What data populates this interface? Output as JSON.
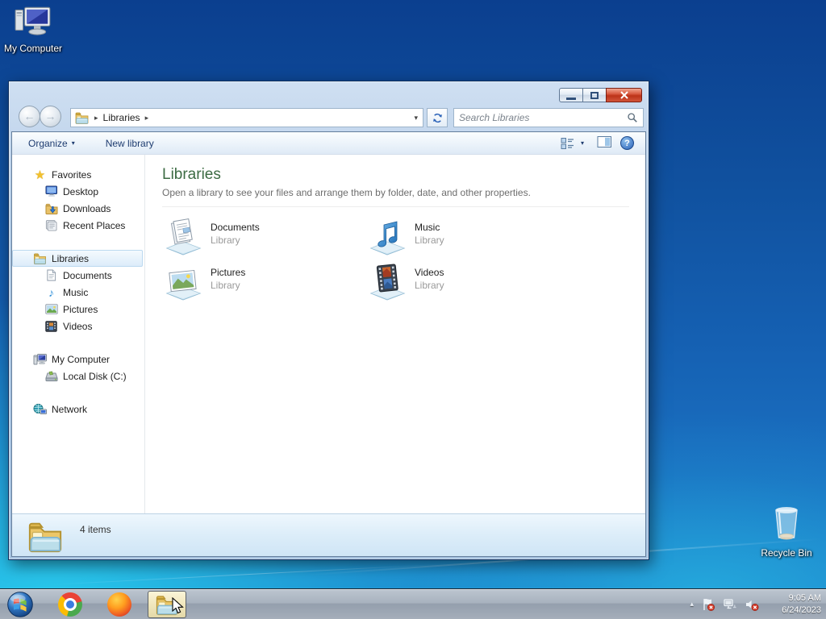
{
  "glyphs": {
    "back_arrow": "←",
    "forward_arrow": "→",
    "chevron_right": "▸",
    "chevron_down": "▾",
    "tray_chevron": "▴",
    "star": "★",
    "music_note": "♪",
    "question": "?"
  },
  "colors": {
    "heading_green": "#3c6b43",
    "close_red": "#bc3318",
    "selection_blue": "#dcecfa"
  },
  "desktop": {
    "my_computer_label": "My Computer",
    "recycle_bin_label": "Recycle Bin"
  },
  "window": {
    "nav": {
      "breadcrumb": "Libraries",
      "search_placeholder": "Search Libraries"
    },
    "toolbar": {
      "organize": "Organize",
      "new_library": "New library"
    },
    "sidebar": {
      "favorites": {
        "label": "Favorites",
        "items": [
          {
            "label": "Desktop"
          },
          {
            "label": "Downloads"
          },
          {
            "label": "Recent Places"
          }
        ]
      },
      "libraries": {
        "label": "Libraries",
        "items": [
          {
            "label": "Documents"
          },
          {
            "label": "Music"
          },
          {
            "label": "Pictures"
          },
          {
            "label": "Videos"
          }
        ]
      },
      "computer": {
        "label": "My Computer",
        "items": [
          {
            "label": "Local Disk (C:)"
          }
        ]
      },
      "network": {
        "label": "Network"
      }
    },
    "content": {
      "title": "Libraries",
      "subtitle": "Open a library to see your files and arrange them by folder, date, and other properties.",
      "items": [
        {
          "name": "Documents",
          "kind": "Library"
        },
        {
          "name": "Music",
          "kind": "Library"
        },
        {
          "name": "Pictures",
          "kind": "Library"
        },
        {
          "name": "Videos",
          "kind": "Library"
        }
      ]
    },
    "status": {
      "count": "4 items"
    }
  },
  "taskbar": {
    "clock_time": "9:05 AM",
    "clock_date": "6/24/2023"
  }
}
